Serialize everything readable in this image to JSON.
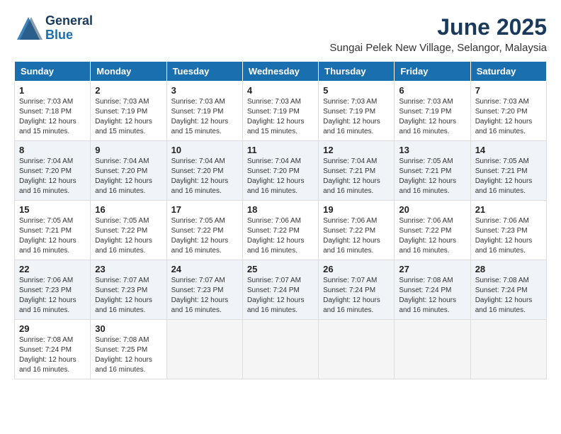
{
  "header": {
    "logo_general": "General",
    "logo_blue": "Blue",
    "month_title": "June 2025",
    "location": "Sungai Pelek New Village, Selangor, Malaysia"
  },
  "weekdays": [
    "Sunday",
    "Monday",
    "Tuesday",
    "Wednesday",
    "Thursday",
    "Friday",
    "Saturday"
  ],
  "weeks": [
    [
      {
        "day": 1,
        "info": "Sunrise: 7:03 AM\nSunset: 7:18 PM\nDaylight: 12 hours\nand 15 minutes."
      },
      {
        "day": 2,
        "info": "Sunrise: 7:03 AM\nSunset: 7:19 PM\nDaylight: 12 hours\nand 15 minutes."
      },
      {
        "day": 3,
        "info": "Sunrise: 7:03 AM\nSunset: 7:19 PM\nDaylight: 12 hours\nand 15 minutes."
      },
      {
        "day": 4,
        "info": "Sunrise: 7:03 AM\nSunset: 7:19 PM\nDaylight: 12 hours\nand 15 minutes."
      },
      {
        "day": 5,
        "info": "Sunrise: 7:03 AM\nSunset: 7:19 PM\nDaylight: 12 hours\nand 16 minutes."
      },
      {
        "day": 6,
        "info": "Sunrise: 7:03 AM\nSunset: 7:19 PM\nDaylight: 12 hours\nand 16 minutes."
      },
      {
        "day": 7,
        "info": "Sunrise: 7:03 AM\nSunset: 7:20 PM\nDaylight: 12 hours\nand 16 minutes."
      }
    ],
    [
      {
        "day": 8,
        "info": "Sunrise: 7:04 AM\nSunset: 7:20 PM\nDaylight: 12 hours\nand 16 minutes."
      },
      {
        "day": 9,
        "info": "Sunrise: 7:04 AM\nSunset: 7:20 PM\nDaylight: 12 hours\nand 16 minutes."
      },
      {
        "day": 10,
        "info": "Sunrise: 7:04 AM\nSunset: 7:20 PM\nDaylight: 12 hours\nand 16 minutes."
      },
      {
        "day": 11,
        "info": "Sunrise: 7:04 AM\nSunset: 7:20 PM\nDaylight: 12 hours\nand 16 minutes."
      },
      {
        "day": 12,
        "info": "Sunrise: 7:04 AM\nSunset: 7:21 PM\nDaylight: 12 hours\nand 16 minutes."
      },
      {
        "day": 13,
        "info": "Sunrise: 7:05 AM\nSunset: 7:21 PM\nDaylight: 12 hours\nand 16 minutes."
      },
      {
        "day": 14,
        "info": "Sunrise: 7:05 AM\nSunset: 7:21 PM\nDaylight: 12 hours\nand 16 minutes."
      }
    ],
    [
      {
        "day": 15,
        "info": "Sunrise: 7:05 AM\nSunset: 7:21 PM\nDaylight: 12 hours\nand 16 minutes."
      },
      {
        "day": 16,
        "info": "Sunrise: 7:05 AM\nSunset: 7:22 PM\nDaylight: 12 hours\nand 16 minutes."
      },
      {
        "day": 17,
        "info": "Sunrise: 7:05 AM\nSunset: 7:22 PM\nDaylight: 12 hours\nand 16 minutes."
      },
      {
        "day": 18,
        "info": "Sunrise: 7:06 AM\nSunset: 7:22 PM\nDaylight: 12 hours\nand 16 minutes."
      },
      {
        "day": 19,
        "info": "Sunrise: 7:06 AM\nSunset: 7:22 PM\nDaylight: 12 hours\nand 16 minutes."
      },
      {
        "day": 20,
        "info": "Sunrise: 7:06 AM\nSunset: 7:22 PM\nDaylight: 12 hours\nand 16 minutes."
      },
      {
        "day": 21,
        "info": "Sunrise: 7:06 AM\nSunset: 7:23 PM\nDaylight: 12 hours\nand 16 minutes."
      }
    ],
    [
      {
        "day": 22,
        "info": "Sunrise: 7:06 AM\nSunset: 7:23 PM\nDaylight: 12 hours\nand 16 minutes."
      },
      {
        "day": 23,
        "info": "Sunrise: 7:07 AM\nSunset: 7:23 PM\nDaylight: 12 hours\nand 16 minutes."
      },
      {
        "day": 24,
        "info": "Sunrise: 7:07 AM\nSunset: 7:23 PM\nDaylight: 12 hours\nand 16 minutes."
      },
      {
        "day": 25,
        "info": "Sunrise: 7:07 AM\nSunset: 7:24 PM\nDaylight: 12 hours\nand 16 minutes."
      },
      {
        "day": 26,
        "info": "Sunrise: 7:07 AM\nSunset: 7:24 PM\nDaylight: 12 hours\nand 16 minutes."
      },
      {
        "day": 27,
        "info": "Sunrise: 7:08 AM\nSunset: 7:24 PM\nDaylight: 12 hours\nand 16 minutes."
      },
      {
        "day": 28,
        "info": "Sunrise: 7:08 AM\nSunset: 7:24 PM\nDaylight: 12 hours\nand 16 minutes."
      }
    ],
    [
      {
        "day": 29,
        "info": "Sunrise: 7:08 AM\nSunset: 7:24 PM\nDaylight: 12 hours\nand 16 minutes."
      },
      {
        "day": 30,
        "info": "Sunrise: 7:08 AM\nSunset: 7:25 PM\nDaylight: 12 hours\nand 16 minutes."
      },
      null,
      null,
      null,
      null,
      null
    ]
  ]
}
